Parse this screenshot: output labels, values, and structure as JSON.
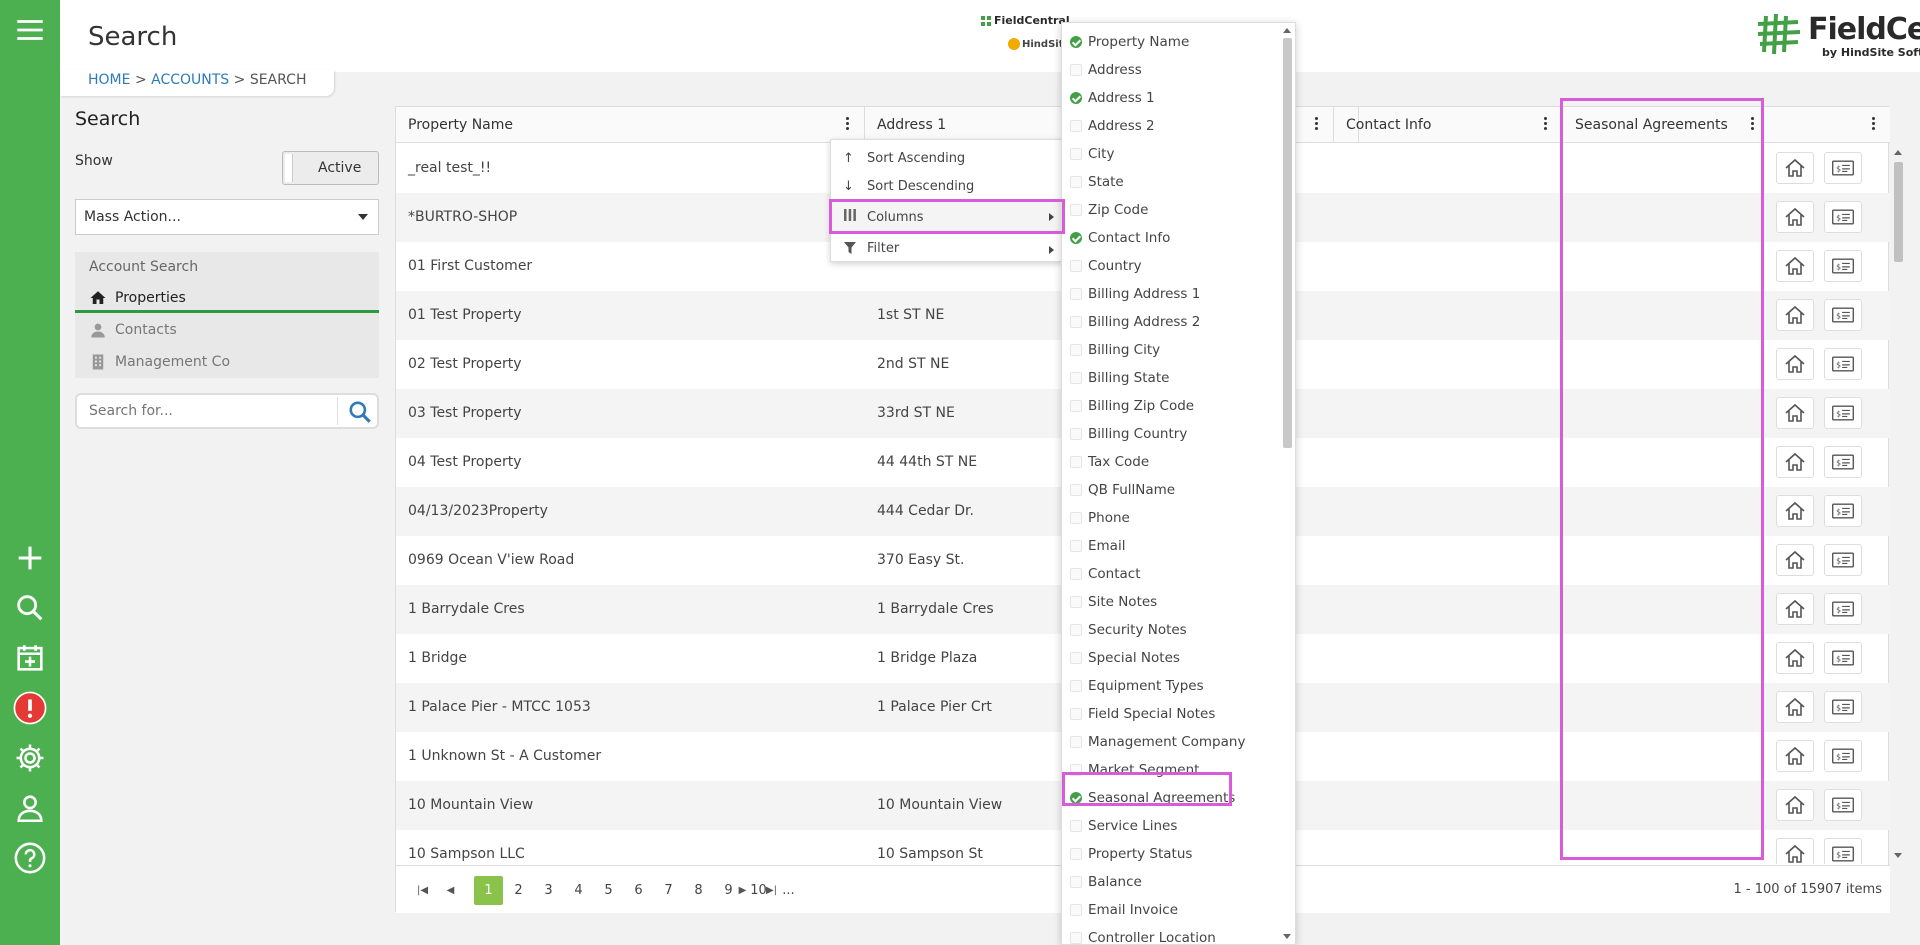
{
  "app": {
    "page_title": "Search"
  },
  "breadcrumb": {
    "home": "HOME",
    "accounts": "ACCOUNTS",
    "current": "SEARCH",
    "sep": ">"
  },
  "header": {
    "small_logo_fc": "FieldCentral",
    "small_logo_hs": "HindSite",
    "brand_name": "FieldCentral",
    "brand_sub": "by HindSite Software"
  },
  "sidebar": {
    "title": "Search",
    "show_label": "Show",
    "toggle_value": "Active",
    "mass_action": "Mass Action...",
    "account_search_label": "Account Search",
    "items": [
      {
        "label": "Properties",
        "icon": "home-icon",
        "active": true
      },
      {
        "label": "Contacts",
        "icon": "person-icon",
        "active": false
      },
      {
        "label": "Management Co",
        "icon": "building-icon",
        "active": false
      }
    ],
    "search_placeholder": "Search for..."
  },
  "grid": {
    "columns": [
      "Property Name",
      "Address 1",
      "",
      "Contact Info",
      "Seasonal Agreements",
      ""
    ],
    "rows": [
      {
        "name": "_real test_!!",
        "address": ""
      },
      {
        "name": "*BURTRO-SHOP",
        "address": ""
      },
      {
        "name": "01 First Customer",
        "address": ""
      },
      {
        "name": "01 Test Property",
        "address": "1st ST NE"
      },
      {
        "name": "02 Test Property",
        "address": "2nd ST NE"
      },
      {
        "name": "03 Test Property",
        "address": "33rd ST NE"
      },
      {
        "name": "04 Test Property",
        "address": "44 44th ST NE"
      },
      {
        "name": "04/13/2023Property",
        "address": "444 Cedar Dr."
      },
      {
        "name": "0969 Ocean V'iew Road",
        "address": "370 Easy St."
      },
      {
        "name": "1 Barrydale Cres",
        "address": "1 Barrydale Cres"
      },
      {
        "name": "1 Bridge",
        "address": "1 Bridge Plaza"
      },
      {
        "name": "1 Palace Pier - MTCC 1053",
        "address": "1 Palace Pier Crt"
      },
      {
        "name": "1 Unknown St - A Customer",
        "address": ""
      },
      {
        "name": "10 Mountain View",
        "address": "10 Mountain View"
      },
      {
        "name": "10 Sampson LLC",
        "address": "10 Sampson St"
      }
    ],
    "pages": [
      "1",
      "2",
      "3",
      "4",
      "5",
      "6",
      "7",
      "8",
      "9",
      "10",
      "..."
    ],
    "current_page": "1",
    "items_count": "1 - 100 of 15907 items"
  },
  "context_menu": {
    "items": [
      {
        "label": "Sort Ascending",
        "icon": "arrow-up-icon"
      },
      {
        "label": "Sort Descending",
        "icon": "arrow-down-icon"
      },
      {
        "label": "Columns",
        "icon": "columns-icon"
      },
      {
        "label": "Filter",
        "icon": "filter-icon"
      }
    ]
  },
  "columns_menu": {
    "options": [
      {
        "label": "Property Name",
        "checked": true
      },
      {
        "label": "Address",
        "checked": false
      },
      {
        "label": "Address 1",
        "checked": true
      },
      {
        "label": "Address 2",
        "checked": false
      },
      {
        "label": "City",
        "checked": false
      },
      {
        "label": "State",
        "checked": false
      },
      {
        "label": "Zip Code",
        "checked": false
      },
      {
        "label": "Contact Info",
        "checked": true
      },
      {
        "label": "Country",
        "checked": false
      },
      {
        "label": "Billing Address 1",
        "checked": false
      },
      {
        "label": "Billing Address 2",
        "checked": false
      },
      {
        "label": "Billing City",
        "checked": false
      },
      {
        "label": "Billing State",
        "checked": false
      },
      {
        "label": "Billing Zip Code",
        "checked": false
      },
      {
        "label": "Billing Country",
        "checked": false
      },
      {
        "label": "Tax Code",
        "checked": false
      },
      {
        "label": "QB FullName",
        "checked": false
      },
      {
        "label": "Phone",
        "checked": false
      },
      {
        "label": "Email",
        "checked": false
      },
      {
        "label": "Contact",
        "checked": false
      },
      {
        "label": "Site Notes",
        "checked": false
      },
      {
        "label": "Security Notes",
        "checked": false
      },
      {
        "label": "Special Notes",
        "checked": false
      },
      {
        "label": "Equipment Types",
        "checked": false
      },
      {
        "label": "Field Special Notes",
        "checked": false
      },
      {
        "label": "Management Company",
        "checked": false
      },
      {
        "label": "Market Segment",
        "checked": false
      },
      {
        "label": "Seasonal Agreements",
        "checked": true
      },
      {
        "label": "Service Lines",
        "checked": false
      },
      {
        "label": "Property Status",
        "checked": false
      },
      {
        "label": "Balance",
        "checked": false
      },
      {
        "label": "Email Invoice",
        "checked": false
      },
      {
        "label": "Controller Location",
        "checked": false
      }
    ]
  },
  "colors": {
    "rail": "#4caf50",
    "accent": "#8bc34a",
    "highlight": "#d85cd8",
    "link": "#2e7bb8"
  }
}
